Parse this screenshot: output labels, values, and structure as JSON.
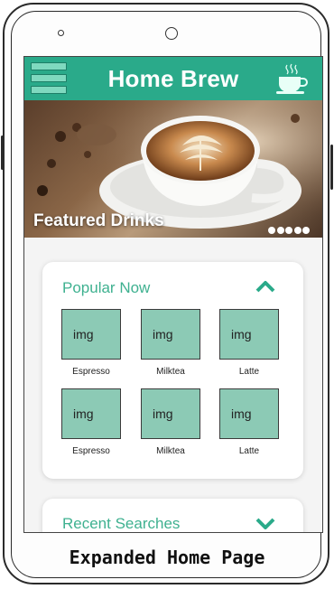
{
  "app": {
    "title": "Home Brew"
  },
  "hero": {
    "caption": "Featured Drinks",
    "dot_count": 5
  },
  "popular": {
    "title": "Popular Now",
    "items": [
      {
        "img": "img",
        "name": "Espresso"
      },
      {
        "img": "img",
        "name": "Milktea"
      },
      {
        "img": "img",
        "name": "Latte"
      },
      {
        "img": "img",
        "name": "Espresso"
      },
      {
        "img": "img",
        "name": "Milktea"
      },
      {
        "img": "img",
        "name": "Latte"
      }
    ]
  },
  "recent": {
    "title": "Recent Searches"
  },
  "caption": "Expanded Home Page",
  "colors": {
    "primary": "#2aaa8a",
    "tile": "#8ccab5",
    "accent_text": "#3fb190"
  }
}
